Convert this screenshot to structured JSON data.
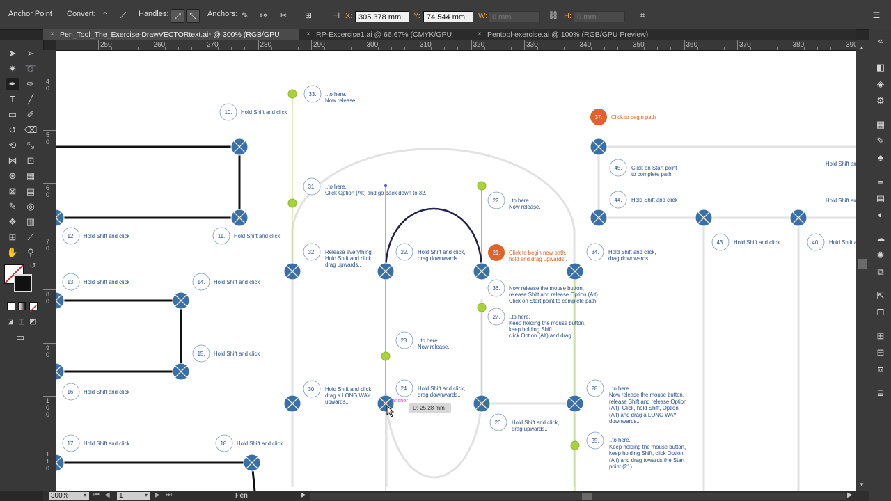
{
  "control_bar": {
    "tool_name": "Anchor Point",
    "convert_label": "Convert:",
    "handles_label": "Handles:",
    "anchors_label": "Anchors:",
    "x_label": "X:",
    "x_value": "305.378 mm",
    "y_label": "Y:",
    "y_value": "74.544 mm",
    "w_label": "W:",
    "w_value": "0 mm",
    "h_label": "H:",
    "h_value": "0 mm"
  },
  "tabs": [
    {
      "label": "Pen_Tool_The_Exercise-DrawVECTORtext.ai* @ 300% (RGB/GPU Preview)",
      "active": true
    },
    {
      "label": "RP-Excercise1.ai @ 66.67% (CMYK/GPU Preview)",
      "active": false
    },
    {
      "label": "Pentool-exercise.ai @ 100% (RGB/GPU Preview)",
      "active": false
    }
  ],
  "ruler_h": [
    "250",
    "260",
    "270",
    "280",
    "290",
    "300",
    "310",
    "320",
    "330",
    "340",
    "350",
    "360",
    "370",
    "380",
    "390"
  ],
  "ruler_v": [
    "4\n0",
    "5\n0",
    "6\n0",
    "7\n0",
    "8\n0",
    "9\n0",
    "1\n0\n0",
    "1\n1\n0"
  ],
  "canvas": {
    "steps": {
      "s10": {
        "num": "10.",
        "text": "Hold Shift and click"
      },
      "s11": {
        "num": "11.",
        "text": "Hold Shift and click"
      },
      "s12": {
        "num": "12.",
        "text": "Hold Shift and click"
      },
      "s13": {
        "num": "13.",
        "text": "Hold Shift and click"
      },
      "s14": {
        "num": "14.",
        "text": "Hold Shift and click"
      },
      "s15": {
        "num": "15.",
        "text": "Hold Shift and click"
      },
      "s16": {
        "num": "16.",
        "text": "Hold Shift and click"
      },
      "s17": {
        "num": "17.",
        "text": "Hold Shift and click"
      },
      "s18": {
        "num": "18.",
        "text": "Hold Shift and click"
      },
      "s21": {
        "num": "21.",
        "text1": "Click to begin new path,",
        "text2": "hold and drag upwards.."
      },
      "s22": {
        "num": "22.",
        "text1": "Hold Shift and click,",
        "text2": "drag downwards.."
      },
      "s22b": {
        "num": "22.",
        "text1": "..to here.",
        "text2": "Now release."
      },
      "s23": {
        "num": "23.",
        "text1": "..to here.",
        "text2": "Now release."
      },
      "s24": {
        "num": "24.",
        "text1": "Hold Shift and click,",
        "text2": "drag downwards.."
      },
      "s26": {
        "num": "26.",
        "text1": "Hold Shift and click,",
        "text2": "drag upwards.."
      },
      "s27": {
        "num": "27.",
        "text1": "..to here.",
        "text2": "Keep holding the mouse button,",
        "text3": "keep holding Shift,",
        "text4": "click Option (Alt) and drag.."
      },
      "s28": {
        "num": "28.",
        "text1": "..to here.",
        "text2": "Now release the mouse button,",
        "text3": "release Shift and release Option",
        "text4": "(Alt). Click, hold Shift, Option",
        "text5": "(Alt) and drag a LONG WAY",
        "text6": "downwards.."
      },
      "s30": {
        "num": "30.",
        "text1": "Hold Shift and click,",
        "text2": "drag a LONG WAY",
        "text3": "upwards.."
      },
      "s31": {
        "num": "31.",
        "text1": "..to here.",
        "text2": "Click Option (Alt) and go back down to 32."
      },
      "s32": {
        "num": "32.",
        "text1": "Release everything.",
        "text2": "Hold Shift and click,",
        "text3": "drag upwards.."
      },
      "s33": {
        "num": "33.",
        "text1": "..to here.",
        "text2": "Now release."
      },
      "s34": {
        "num": "34.",
        "text1": "Hold Shift and click,",
        "text2": "drag downwards.."
      },
      "s35": {
        "num": "35.",
        "text1": "..to here.",
        "text2": "Keep holding the mouse button,",
        "text3": "keep holding Shift, click Option",
        "text4": "(Alt) and drag towards the Start",
        "text5": "point (21)."
      },
      "s36": {
        "num": "36.",
        "text1": "Now release the mouse button,",
        "text2": "release Shift and release Option (Alt).",
        "text3": "Click on Start point to complete path."
      },
      "s37": {
        "num": "37.",
        "text": "Click to begin path"
      },
      "s40": {
        "num": "40.",
        "text": "Hold Shift a"
      },
      "s43": {
        "num": "43.",
        "text": "Hold Shift and click"
      },
      "s44": {
        "num": "44.",
        "text": "Hold Shift and click"
      },
      "s45": {
        "num": "45.",
        "text1": "Click on Start point",
        "text2": "to complete path"
      },
      "edge1": "Hold Shift an",
      "edge2": "Hold Shift an"
    },
    "anchor_hint": "anchor",
    "distance_tooltip": "D: 25.28 mm"
  },
  "status": {
    "zoom": "300%",
    "artboard": "1",
    "tool": "Pen"
  },
  "colors": {
    "anchor_blue": "#3a6fa8",
    "handle_green": "#a8d23a",
    "step_orange": "#e0632a",
    "text_blue": "#2a4f86"
  }
}
